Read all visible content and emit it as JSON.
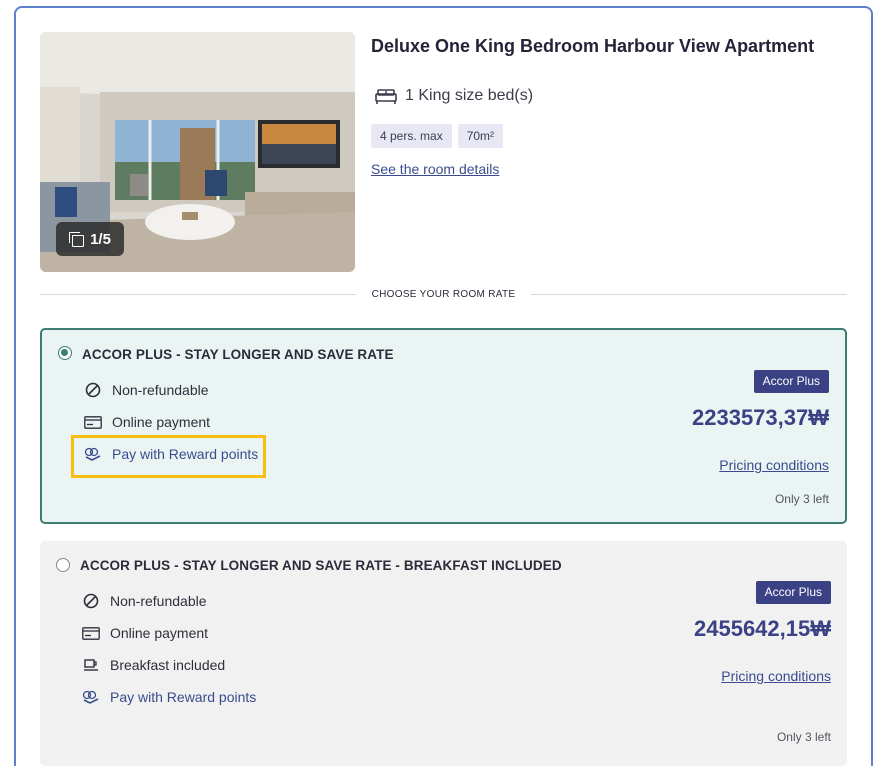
{
  "room": {
    "title": "Deluxe One King Bedroom Harbour View Apartment",
    "bed": "1 King size bed(s)",
    "chips": [
      "4 pers. max",
      "70m²"
    ],
    "details_link": "See the room details",
    "photo_counter": "1/5"
  },
  "section_label": "CHOOSE YOUR ROOM RATE",
  "rates": [
    {
      "name": "ACCOR PLUS - STAY LONGER AND SAVE RATE",
      "selected": true,
      "features": [
        "Non-refundable",
        "Online payment",
        "Pay with Reward points"
      ],
      "badge": "Accor Plus",
      "price": "2233573,37₩",
      "pricing_link": "Pricing conditions",
      "availability": "Only 3 left"
    },
    {
      "name": "ACCOR PLUS - STAY LONGER AND SAVE RATE - BREAKFAST INCLUDED",
      "selected": false,
      "features": [
        "Non-refundable",
        "Online payment",
        "Breakfast included",
        "Pay with Reward points"
      ],
      "badge": "Accor Plus",
      "price": "2455642,15₩",
      "pricing_link": "Pricing conditions",
      "availability": "Only 3 left"
    }
  ],
  "colors": {
    "card_border": "#5e7fc9",
    "selected_bg": "#eaf5f3",
    "selected_border": "#3b7d72",
    "price": "#3a4184",
    "highlight": "#f7bd11"
  }
}
